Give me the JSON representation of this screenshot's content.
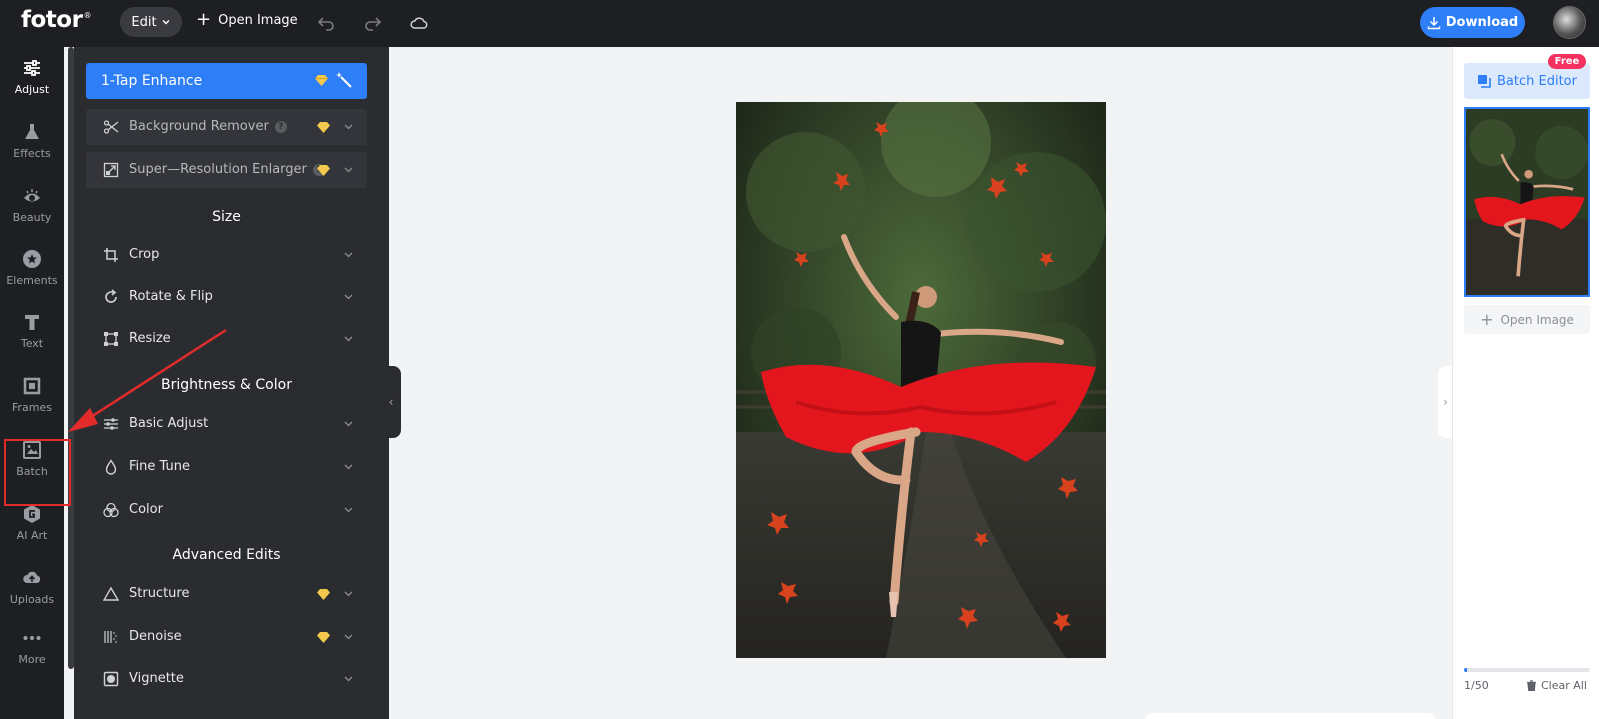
{
  "topbar": {
    "logo": "fotor",
    "logo_mark": "®",
    "edit_label": "Edit",
    "open_image_label": "Open Image",
    "download_label": "Download"
  },
  "rail": {
    "items": [
      {
        "label": "Adjust",
        "icon": "sliders-icon",
        "active": true
      },
      {
        "label": "Effects",
        "icon": "flask-icon"
      },
      {
        "label": "Beauty",
        "icon": "eye-icon"
      },
      {
        "label": "Elements",
        "icon": "star-icon"
      },
      {
        "label": "Text",
        "icon": "text-icon"
      },
      {
        "label": "Frames",
        "icon": "frame-icon"
      },
      {
        "label": "Batch",
        "icon": "images-icon"
      },
      {
        "label": "AI Art",
        "icon": "ai-art-icon"
      },
      {
        "label": "Uploads",
        "icon": "cloud-upload-icon"
      },
      {
        "label": "More",
        "icon": "more-icon"
      }
    ]
  },
  "panel": {
    "enhance_label": "1-Tap Enhance",
    "background_remover": "Background Remover",
    "super_resolution": "Super—Resolution Enlarger",
    "sections": {
      "size": "Size",
      "brightness": "Brightness & Color",
      "advanced": "Advanced Edits"
    },
    "size_tools": [
      "Crop",
      "Rotate & Flip",
      "Resize"
    ],
    "brightness_tools": [
      "Basic Adjust",
      "Fine Tune",
      "Color"
    ],
    "advanced_tools": [
      "Structure",
      "Denoise",
      "Vignette"
    ]
  },
  "right": {
    "batch_editor_label": "Batch Editor",
    "free_badge": "Free",
    "open_image_label": "Open Image",
    "image_count": "1/50",
    "progress_fraction": 0.02,
    "clear_all_label": "Clear All"
  },
  "colors": {
    "accent": "#2d7ef7",
    "dark_bg": "#1e1f22",
    "panel_bg": "#2b2c30",
    "badge": "#f5315f",
    "annotation": "#e32b2b",
    "premium_gem": "#f2c94c"
  }
}
